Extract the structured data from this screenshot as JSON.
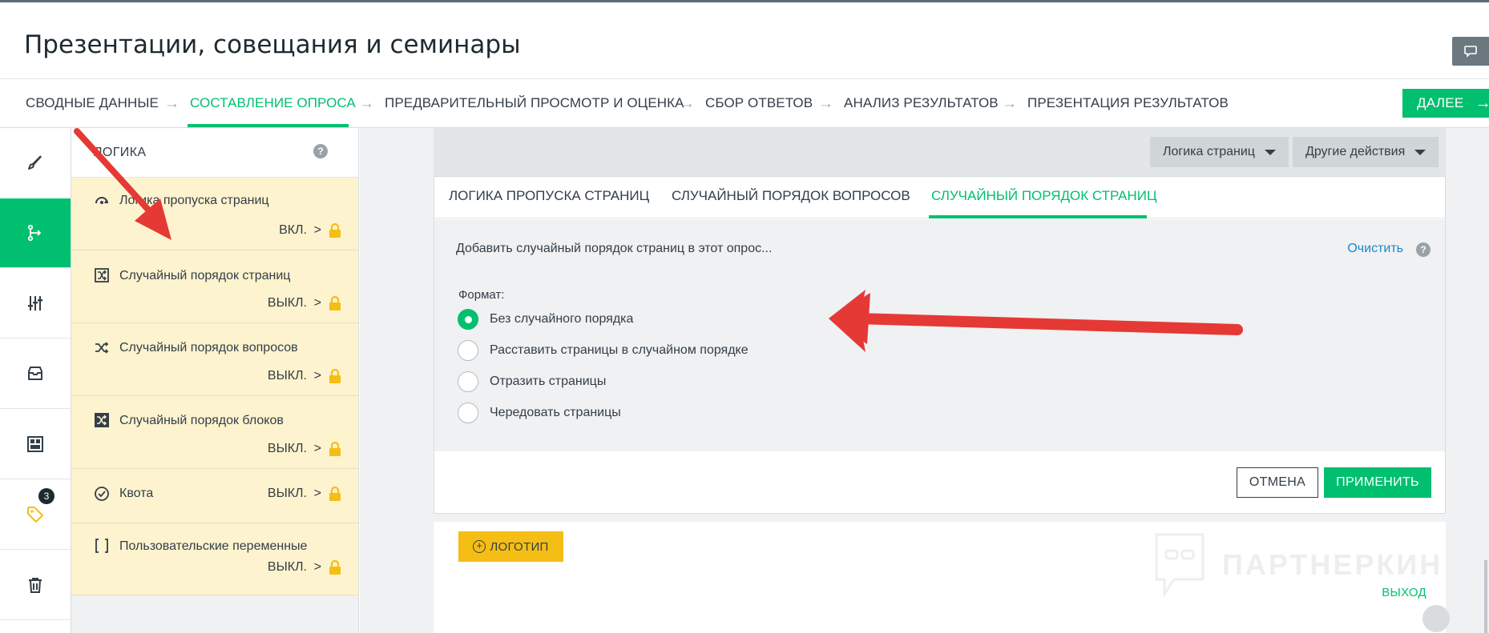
{
  "header": {
    "title": "Презентации, совещания и семинары"
  },
  "nav": {
    "steps": [
      {
        "label": "СВОДНЫЕ ДАННЫЕ"
      },
      {
        "label": "СОСТАВЛЕНИЕ ОПРОСА"
      },
      {
        "label": "ПРЕДВАРИТЕЛЬНЫЙ ПРОСМОТР И ОЦЕНКА"
      },
      {
        "label": "СБОР ОТВЕТОВ"
      },
      {
        "label": "АНАЛИЗ РЕЗУЛЬТАТОВ"
      },
      {
        "label": "ПРЕЗЕНТАЦИЯ РЕЗУЛЬТАТОВ"
      }
    ],
    "active_step": "СОСТАВЛЕНИЕ ОПРОСА",
    "next_label": "ДАЛЕЕ"
  },
  "leftbar": {
    "items": [
      {
        "icon": "brush-icon"
      },
      {
        "icon": "logic-branch-icon"
      },
      {
        "icon": "sliders-icon"
      },
      {
        "icon": "inbox-icon"
      },
      {
        "icon": "layout-icon"
      },
      {
        "icon": "tag-icon",
        "badge": "3"
      },
      {
        "icon": "trash-icon"
      }
    ]
  },
  "logic_panel": {
    "title": "ЛОГИКА",
    "items": [
      {
        "label": "Логика пропуска страниц",
        "state": "ВКЛ.",
        "icon": "skip-logic-icon"
      },
      {
        "label": "Случайный порядок страниц",
        "state": "ВЫКЛ.",
        "icon": "random-pages-icon"
      },
      {
        "label": "Случайный порядок вопросов",
        "state": "ВЫКЛ.",
        "icon": "shuffle-icon"
      },
      {
        "label": "Случайный порядок блоков",
        "state": "ВЫКЛ.",
        "icon": "random-blocks-icon"
      },
      {
        "label": "Квота",
        "state": "ВЫКЛ.",
        "icon": "check-circle-icon"
      },
      {
        "label": "Пользовательские переменные",
        "state": "ВЫКЛ.",
        "icon": "brackets-icon"
      }
    ]
  },
  "toolbar": {
    "page_logic_label": "Логика страниц",
    "other_actions_label": "Другие действия"
  },
  "card": {
    "tabs": [
      {
        "label": "ЛОГИКА ПРОПУСКА СТРАНИЦ"
      },
      {
        "label": "СЛУЧАЙНЫЙ ПОРЯДОК ВОПРОСОВ"
      },
      {
        "label": "СЛУЧАЙНЫЙ ПОРЯДОК СТРАНИЦ"
      }
    ],
    "active_tab": "СЛУЧАЙНЫЙ ПОРЯДОК СТРАНИЦ",
    "description": "Добавить случайный порядок страниц в этот опрос...",
    "clear_label": "Очистить",
    "format_label": "Формат:",
    "options": [
      {
        "label": "Без случайного порядка",
        "checked": true
      },
      {
        "label": "Расставить страницы в случайном порядке",
        "checked": false
      },
      {
        "label": "Отразить страницы",
        "checked": false
      },
      {
        "label": "Чередовать страницы",
        "checked": false
      }
    ],
    "cancel_label": "ОТМЕНА",
    "apply_label": "ПРИМЕНИТЬ"
  },
  "canvas": {
    "logo_label": "ЛОГОТИП",
    "exit_label": "ВЫХОД",
    "watermark": "ПАРТНЕРКИН"
  },
  "colors": {
    "accent": "#00bf6f",
    "logic_item_bg": "#fdf3ce",
    "lock": "#f5be15",
    "annotation_arrow": "#e53935",
    "link": "#1b87c9"
  }
}
